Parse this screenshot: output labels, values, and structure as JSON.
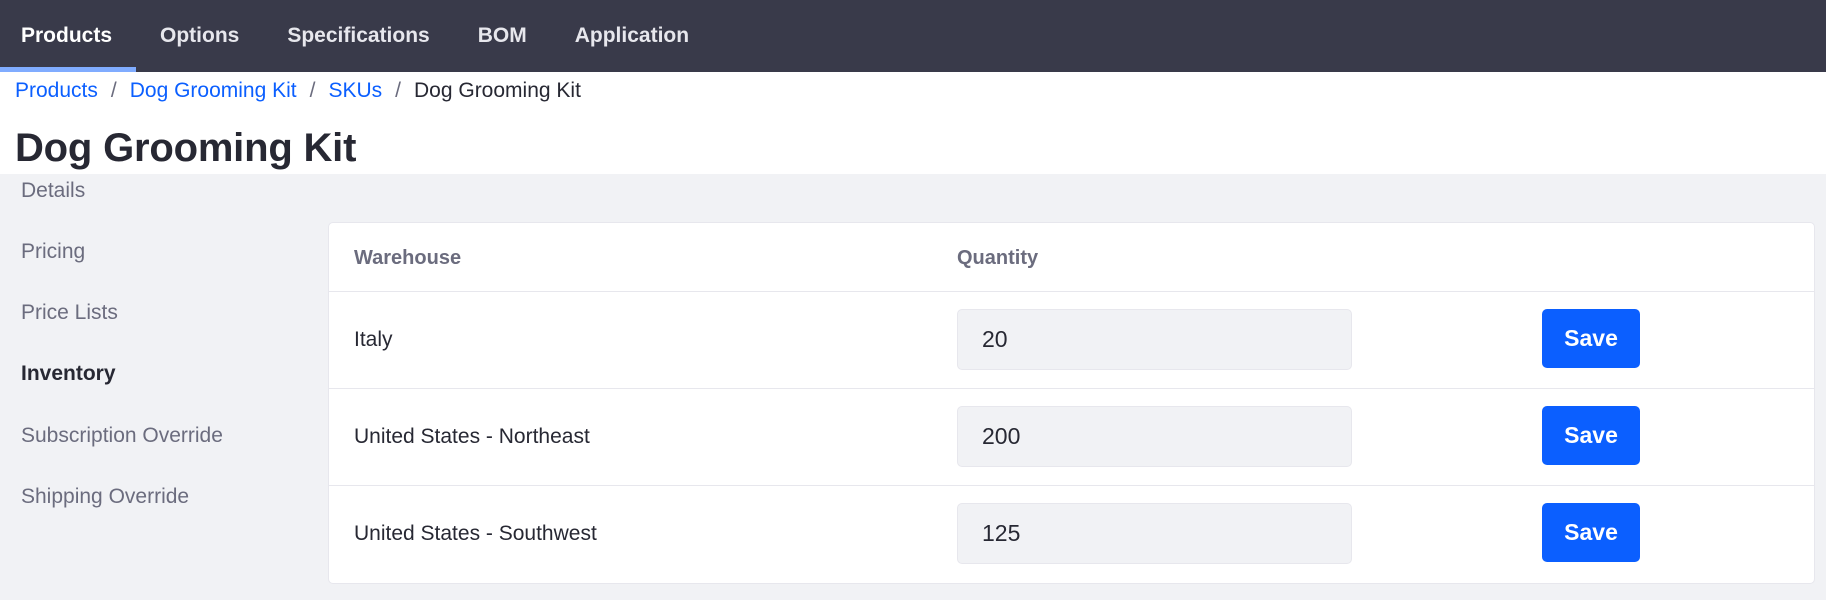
{
  "topnav": {
    "tabs": [
      {
        "label": "Products",
        "active": true
      },
      {
        "label": "Options",
        "active": false
      },
      {
        "label": "Specifications",
        "active": false
      },
      {
        "label": "BOM",
        "active": false
      },
      {
        "label": "Application",
        "active": false
      }
    ]
  },
  "breadcrumb": {
    "items": [
      "Products",
      "Dog Grooming Kit",
      "SKUs"
    ],
    "current": "Dog Grooming Kit",
    "separator": "/"
  },
  "page": {
    "title": "Dog Grooming Kit"
  },
  "sidebar": {
    "items": [
      {
        "label": "Details",
        "active": false
      },
      {
        "label": "Pricing",
        "active": false
      },
      {
        "label": "Price Lists",
        "active": false
      },
      {
        "label": "Inventory",
        "active": true
      },
      {
        "label": "Subscription Override",
        "active": false
      },
      {
        "label": "Shipping Override",
        "active": false
      }
    ]
  },
  "inventory": {
    "columns": {
      "warehouse": "Warehouse",
      "quantity": "Quantity"
    },
    "rows": [
      {
        "warehouse": "Italy",
        "quantity": "20",
        "save_label": "Save"
      },
      {
        "warehouse": "United States - Northeast",
        "quantity": "200",
        "save_label": "Save"
      },
      {
        "warehouse": "United States - Southwest",
        "quantity": "125",
        "save_label": "Save"
      }
    ]
  },
  "colors": {
    "topnav_bg": "#393a4a",
    "active_tab_indicator": "#80acff",
    "link": "#0b5fff",
    "primary_button": "#0b5fff",
    "page_bg": "#f1f2f5"
  }
}
